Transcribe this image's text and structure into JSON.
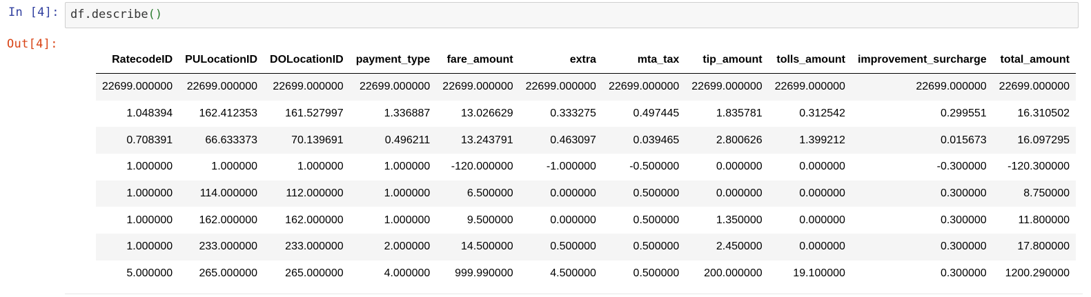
{
  "cell": {
    "in_prompt": "In [4]:",
    "code_fn": "df.describe",
    "code_paren": "()",
    "out_prompt": "Out[4]:"
  },
  "table": {
    "columns": [
      "RatecodeID",
      "PULocationID",
      "DOLocationID",
      "payment_type",
      "fare_amount",
      "extra",
      "mta_tax",
      "tip_amount",
      "tolls_amount",
      "improvement_surcharge",
      "total_amount"
    ],
    "rows": [
      [
        "22699.000000",
        "22699.000000",
        "22699.000000",
        "22699.000000",
        "22699.000000",
        "22699.000000",
        "22699.000000",
        "22699.000000",
        "22699.000000",
        "22699.000000",
        "22699.000000"
      ],
      [
        "1.048394",
        "162.412353",
        "161.527997",
        "1.336887",
        "13.026629",
        "0.333275",
        "0.497445",
        "1.835781",
        "0.312542",
        "0.299551",
        "16.310502"
      ],
      [
        "0.708391",
        "66.633373",
        "70.139691",
        "0.496211",
        "13.243791",
        "0.463097",
        "0.039465",
        "2.800626",
        "1.399212",
        "0.015673",
        "16.097295"
      ],
      [
        "1.000000",
        "1.000000",
        "1.000000",
        "1.000000",
        "-120.000000",
        "-1.000000",
        "-0.500000",
        "0.000000",
        "0.000000",
        "-0.300000",
        "-120.300000"
      ],
      [
        "1.000000",
        "114.000000",
        "112.000000",
        "1.000000",
        "6.500000",
        "0.000000",
        "0.500000",
        "0.000000",
        "0.000000",
        "0.300000",
        "8.750000"
      ],
      [
        "1.000000",
        "162.000000",
        "162.000000",
        "1.000000",
        "9.500000",
        "0.000000",
        "0.500000",
        "1.350000",
        "0.000000",
        "0.300000",
        "11.800000"
      ],
      [
        "1.000000",
        "233.000000",
        "233.000000",
        "2.000000",
        "14.500000",
        "0.500000",
        "0.500000",
        "2.450000",
        "0.000000",
        "0.300000",
        "17.800000"
      ],
      [
        "5.000000",
        "265.000000",
        "265.000000",
        "4.000000",
        "999.990000",
        "4.500000",
        "0.500000",
        "200.000000",
        "19.100000",
        "0.300000",
        "1200.290000"
      ]
    ]
  },
  "colors": {
    "in_prompt": "#303f9f",
    "out_prompt": "#d84315",
    "code_paren": "#2e7d32",
    "input_bg": "#f7f7f7",
    "stripe": "#f5f5f5"
  }
}
